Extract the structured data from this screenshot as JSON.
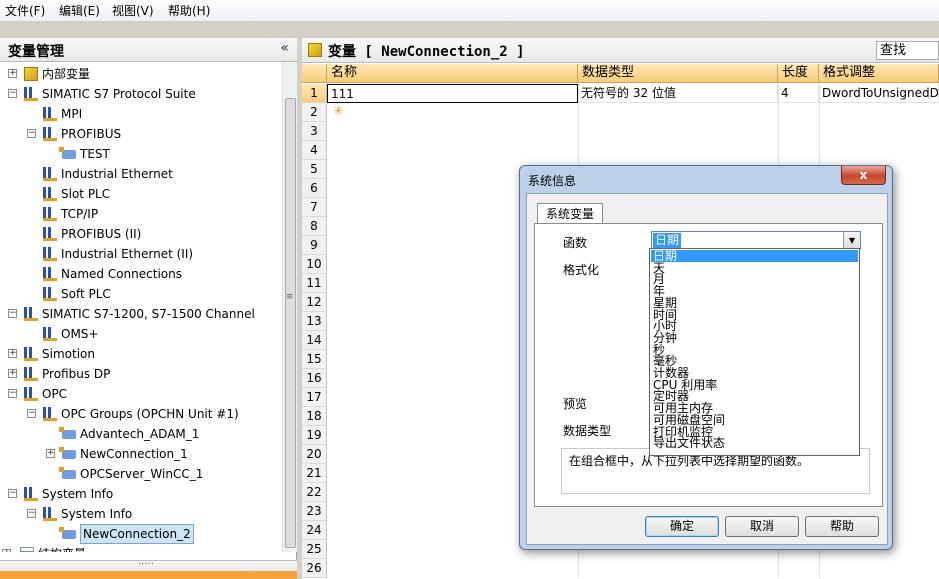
{
  "menu": [
    "文件(F)",
    "编辑(E)",
    "视图(V)",
    "帮助(H)"
  ],
  "left_panel": {
    "title": "变量管理",
    "collapse_glyph": "«",
    "tree": [
      {
        "label": "内部变量",
        "level": 1,
        "icon": "cube-icon",
        "expander": "+"
      },
      {
        "label": "SIMATIC S7 Protocol Suite",
        "level": 1,
        "icon": "driver-icon",
        "expander": "-"
      },
      {
        "label": "MPI",
        "level": 2,
        "icon": "channel-unit-icon",
        "expander": ""
      },
      {
        "label": "PROFIBUS",
        "level": 2,
        "icon": "channel-unit-icon",
        "expander": "-"
      },
      {
        "label": "TEST",
        "level": 3,
        "icon": "connection-icon",
        "expander": ""
      },
      {
        "label": "Industrial Ethernet",
        "level": 2,
        "icon": "channel-unit-icon",
        "expander": ""
      },
      {
        "label": "Slot PLC",
        "level": 2,
        "icon": "channel-unit-icon",
        "expander": ""
      },
      {
        "label": "TCP/IP",
        "level": 2,
        "icon": "channel-unit-icon",
        "expander": ""
      },
      {
        "label": "PROFIBUS (II)",
        "level": 2,
        "icon": "channel-unit-icon",
        "expander": ""
      },
      {
        "label": "Industrial Ethernet (II)",
        "level": 2,
        "icon": "channel-unit-icon",
        "expander": ""
      },
      {
        "label": "Named Connections",
        "level": 2,
        "icon": "channel-unit-icon",
        "expander": ""
      },
      {
        "label": "Soft PLC",
        "level": 2,
        "icon": "channel-unit-icon",
        "expander": ""
      },
      {
        "label": "SIMATIC S7-1200, S7-1500 Channel",
        "level": 1,
        "icon": "driver-icon",
        "expander": "-"
      },
      {
        "label": "OMS+",
        "level": 2,
        "icon": "channel-unit-icon",
        "expander": ""
      },
      {
        "label": "Simotion",
        "level": 1,
        "icon": "driver-icon",
        "expander": "+"
      },
      {
        "label": "Profibus DP",
        "level": 1,
        "icon": "driver-icon",
        "expander": "+"
      },
      {
        "label": "OPC",
        "level": 1,
        "icon": "driver-icon",
        "expander": "-"
      },
      {
        "label": "OPC Groups (OPCHN Unit #1)",
        "level": 2,
        "icon": "channel-unit-icon",
        "expander": "-"
      },
      {
        "label": "Advantech_ADAM_1",
        "level": 3,
        "icon": "connection-icon",
        "expander": ""
      },
      {
        "label": "NewConnection_1",
        "level": 3,
        "icon": "connection-icon",
        "expander": "+"
      },
      {
        "label": "OPCServer_WinCC_1",
        "level": 3,
        "icon": "connection-icon",
        "expander": ""
      },
      {
        "label": "System Info",
        "level": 1,
        "icon": "driver-icon",
        "expander": "-"
      },
      {
        "label": "System Info",
        "level": 2,
        "icon": "channel-unit-icon",
        "expander": "-"
      },
      {
        "label": "NewConnection_2",
        "level": 3,
        "icon": "connection-icon",
        "expander": "",
        "selected": true
      },
      {
        "label": "结构变量",
        "level": 0,
        "icon": "struct-icon",
        "expander": "+"
      }
    ],
    "bottom_dots": "·····"
  },
  "right_panel": {
    "title": "变量 [ NewConnection_2 ]",
    "search_placeholder": "查找",
    "columns": [
      "名称",
      "数据类型",
      "长度",
      "格式调整"
    ],
    "rows": [
      {
        "num": "1",
        "name": "111",
        "type": "无符号的 32 位值",
        "length": "4",
        "format": "DwordToUnsignedDw"
      }
    ],
    "row_numbers": [
      "1",
      "2",
      "3",
      "4",
      "5",
      "6",
      "7",
      "8",
      "9",
      "10",
      "11",
      "12",
      "13",
      "14",
      "15",
      "16",
      "17",
      "18",
      "19",
      "20",
      "21",
      "22",
      "23",
      "24",
      "25",
      "26"
    ]
  },
  "dialog": {
    "title": "系统信息",
    "close_glyph": "x",
    "tab": "系统变量",
    "labels": {
      "function": "函数",
      "format": "格式化",
      "preview": "预览",
      "data_type": "数据类型"
    },
    "function_value": "日期",
    "dropdown_options": [
      "日期",
      "天",
      "月",
      "年",
      "星期",
      "时间",
      "小时",
      "分钟",
      "秒",
      "毫秒",
      "计数器",
      "CPU 利用率",
      "定时器",
      "可用主内存",
      "可用磁盘空间",
      "打印机监控",
      "导出文件状态"
    ],
    "description": "在组合框中，从下拉列表中选择期望的函数。",
    "buttons": {
      "ok": "确定",
      "cancel": "取消",
      "help": "帮助"
    }
  }
}
